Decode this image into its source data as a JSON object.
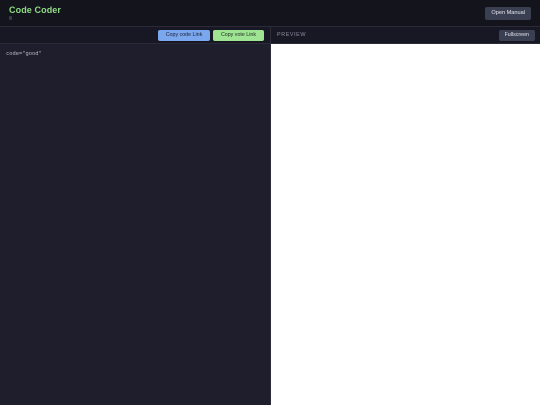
{
  "header": {
    "title": "Code Coder",
    "manual_button": "Open Manual"
  },
  "editor": {
    "copy_code_button": "Copy code Link",
    "copy_vote_button": "Copy vote Link",
    "code_lines": [
      "code=\"good\""
    ]
  },
  "preview": {
    "label": "PREVIEW",
    "fullscreen_button": "Fullscreen"
  },
  "colors": {
    "title_green": "#8fdc84",
    "copy_code_blue": "#7ba7ee",
    "copy_vote_green": "#9ee492",
    "background": "#1e1e2d"
  }
}
